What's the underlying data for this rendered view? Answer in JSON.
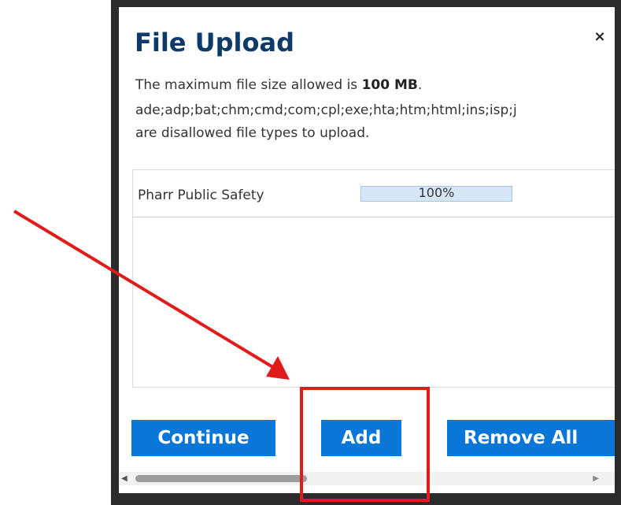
{
  "dialog": {
    "title": "File Upload",
    "close_label": "×",
    "info_line1_prefix": "The maximum file size allowed is ",
    "info_line1_size": "100 MB",
    "info_line1_suffix": ".",
    "info_line2": "ade;adp;bat;chm;cmd;com;cpl;exe;hta;htm;html;ins;isp;j",
    "info_line3": "are disallowed file types to upload."
  },
  "files": [
    {
      "name": "Pharr Public Safety",
      "progress_label": "100%",
      "progress_fraction": 1.0
    }
  ],
  "buttons": {
    "continue_label": "Continue",
    "add_label": "Add",
    "remove_all_label": "Remove All"
  },
  "scrollbar": {
    "left_arrow": "◀",
    "right_arrow": "▶"
  },
  "colors": {
    "title": "#0d3a68",
    "button_bg": "#0a76d8",
    "annotation_red": "#e01b1b"
  }
}
